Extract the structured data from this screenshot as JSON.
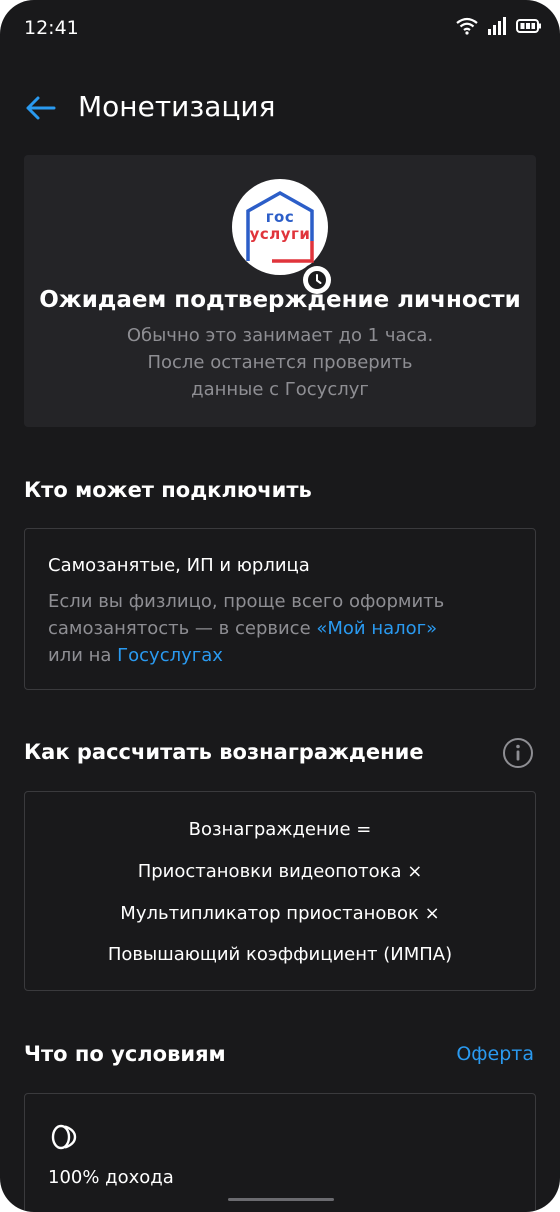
{
  "status_bar": {
    "time": "12:41"
  },
  "app_bar": {
    "title": "Монетизация"
  },
  "status_card": {
    "logo_line1": "гос",
    "logo_line2": "услуги",
    "title": "Ожидаем подтверждение личности",
    "desc_line1": "Обычно это занимает до 1 часа.",
    "desc_line2": "После останется проверить",
    "desc_line3": "данные с Госуслуг"
  },
  "who": {
    "title": "Кто может подключить",
    "card_title": "Самозанятые, ИП и юрлица",
    "text_part1": "Если вы физлицо, проще всего оформить самозанятость — в сервисе ",
    "link1": "«Мой налог»",
    "text_part2": "или на ",
    "link2": "Госуслугах"
  },
  "reward": {
    "title": "Как рассчитать вознаграждение",
    "line1": "Вознаграждение  =",
    "line2": "Приостановки видеопотока  ×",
    "line3": "Мультипликатор приостановок  ×",
    "line4": "Повышающий коэффициент (ИМПА)"
  },
  "conditions": {
    "title": "Что по условиям",
    "offer_link": "Оферта",
    "income": "100% дохода",
    "subtext": ""
  },
  "colors": {
    "background": "#19191b",
    "card": "#242427",
    "accent": "#2a9af0",
    "muted": "#8e8e93"
  }
}
